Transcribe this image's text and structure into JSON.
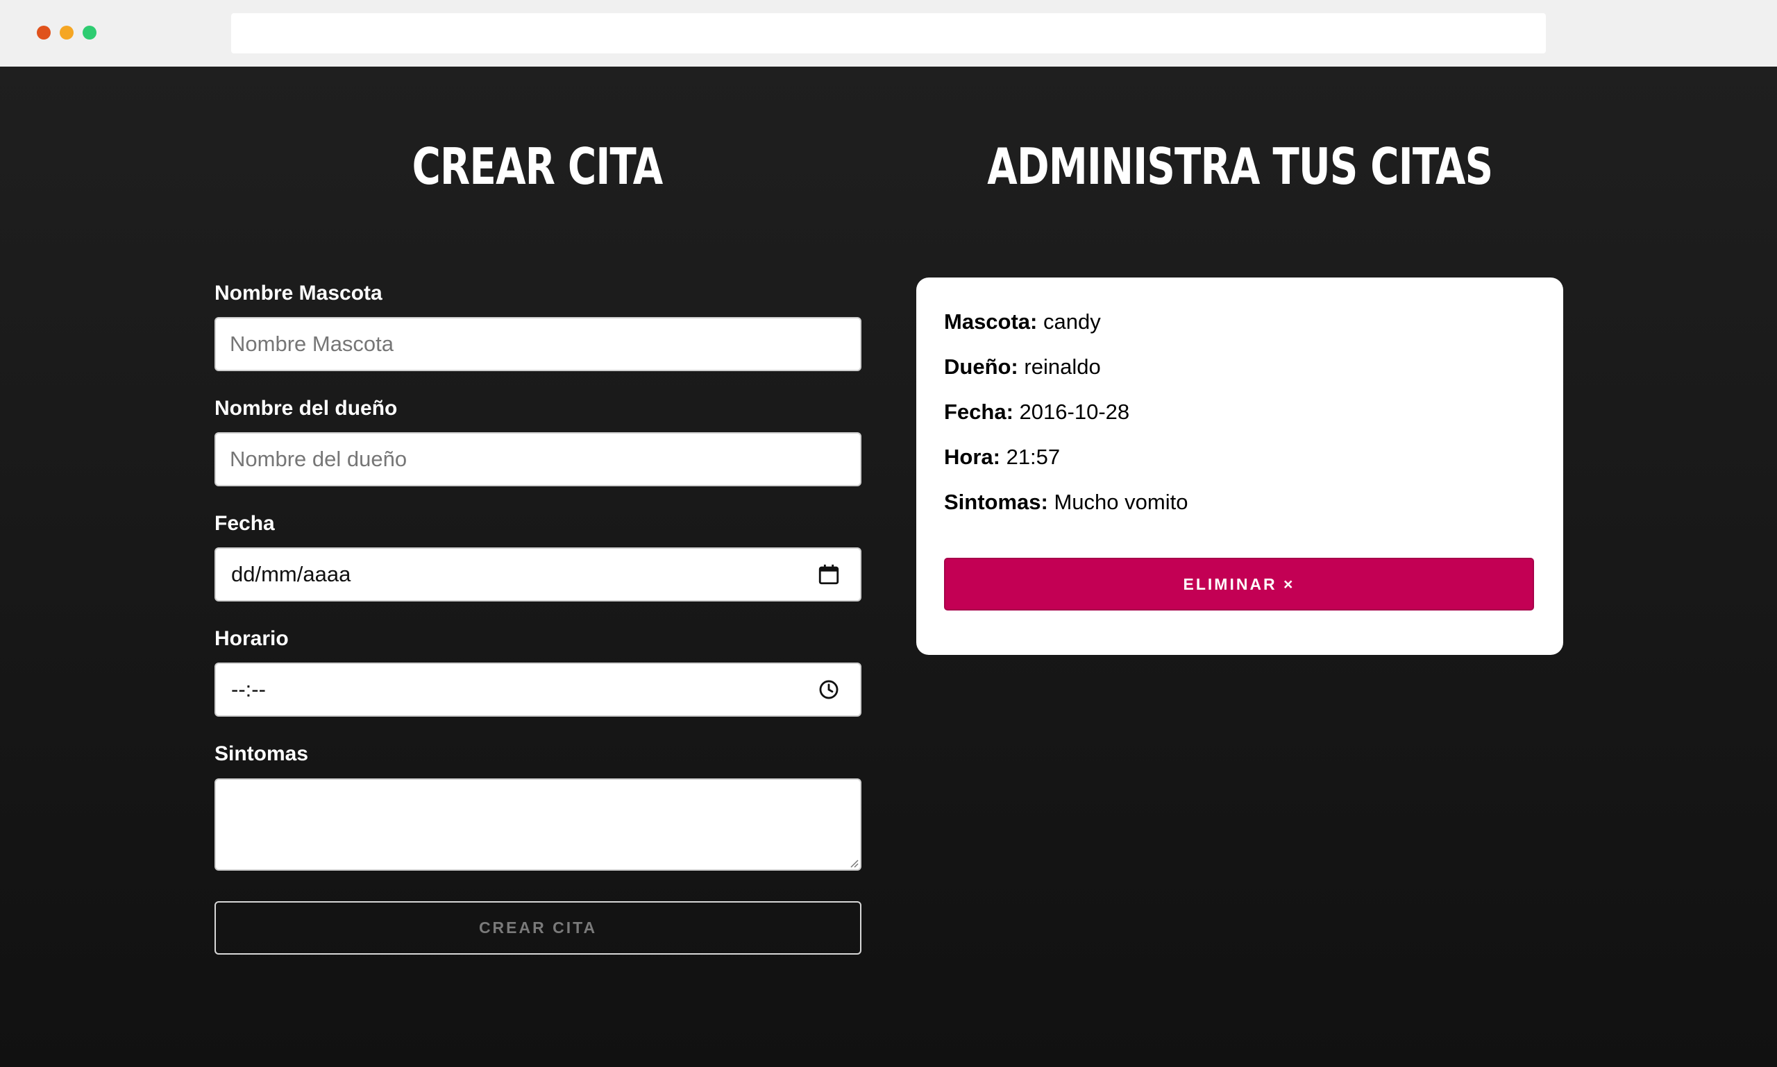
{
  "window": {
    "controls": {
      "close_color": "#e0521c",
      "minimize_color": "#f5a623",
      "maximize_color": "#2ecc71"
    },
    "address_bar": ""
  },
  "left": {
    "title": "Crear Cita",
    "fields": {
      "mascota": {
        "label": "Nombre Mascota",
        "placeholder": "Nombre Mascota",
        "value": ""
      },
      "dueno": {
        "label": "Nombre del dueño",
        "placeholder": "Nombre del dueño",
        "value": ""
      },
      "fecha": {
        "label": "Fecha",
        "display": "dd/mm/aaaa",
        "icon": "calendar-icon"
      },
      "hora": {
        "label": "Horario",
        "display": "--:--",
        "icon": "clock-icon"
      },
      "sintomas": {
        "label": "Sintomas",
        "value": ""
      }
    },
    "submit_label": "Crear Cita"
  },
  "right": {
    "title": "Administra tus citas",
    "appointment": {
      "mascota_key": "Mascota:",
      "mascota_value": "candy",
      "dueno_key": "Dueño:",
      "dueno_value": "reinaldo",
      "fecha_key": "Fecha:",
      "fecha_value": "2016-10-28",
      "hora_key": "Hora:",
      "hora_value": "21:57",
      "sintomas_key": "Sintomas:",
      "sintomas_value": "Mucho vomito",
      "delete_label": "Eliminar ×"
    }
  },
  "colors": {
    "background_top": "#1f1f1f",
    "background_bottom": "#111111",
    "accent_delete": "#c30054"
  }
}
